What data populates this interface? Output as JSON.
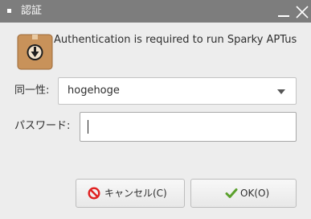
{
  "window": {
    "title": "認証",
    "controls": {
      "minimize_icon": "minimize-icon",
      "close_icon": "close-icon"
    }
  },
  "dialog": {
    "icon": "package-download-icon",
    "message": "Authentication is required to run Sparky APTus"
  },
  "form": {
    "identity_label": "同一性:",
    "identity_value": "hogehoge",
    "password_label": "パスワード:",
    "password_value": ""
  },
  "buttons": {
    "cancel_label": "キャンセル(C)",
    "cancel_icon": "cancel-icon",
    "ok_label": "OK(O)",
    "ok_icon": "checkmark-icon"
  },
  "colors": {
    "titlebar": "#7d7d7d",
    "background": "#ededed",
    "cancel_icon": "#e02020",
    "ok_icon": "#5aa02c"
  }
}
